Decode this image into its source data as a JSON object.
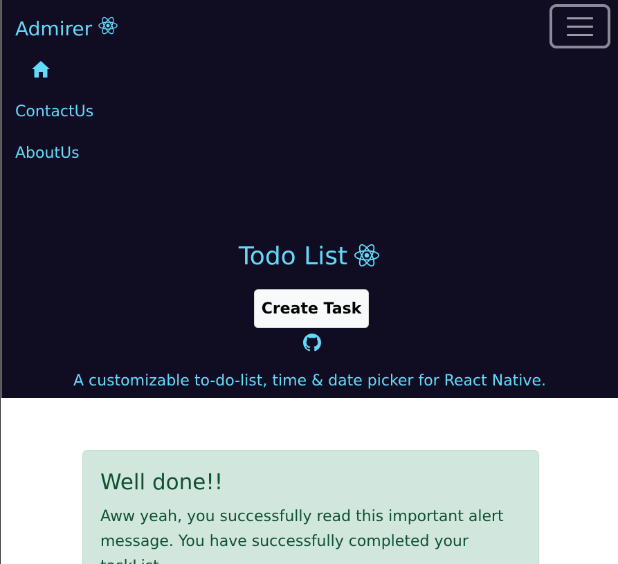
{
  "navbar": {
    "brand_label": "Admirer",
    "brand_icon": "react-logo-icon",
    "toggler_icon": "hamburger-menu-icon",
    "home_icon": "home-icon",
    "links": {
      "contact": "ContactUs",
      "about": "AboutUs"
    }
  },
  "hero": {
    "title": "Todo List",
    "title_icon": "react-logo-icon",
    "create_button": "Create Task",
    "github_icon": "github-icon",
    "tagline": "A customizable to-do-list, time & date picker for React Native."
  },
  "alert": {
    "heading": "Well done!!",
    "message": "Aww yeah, you successfully read this important alert message. You have successfully completed your taskList."
  },
  "colors": {
    "hero_background": "#100d23",
    "accent": "#61dafb",
    "alert_background": "#d1e7dd",
    "alert_text": "#0f5132"
  }
}
